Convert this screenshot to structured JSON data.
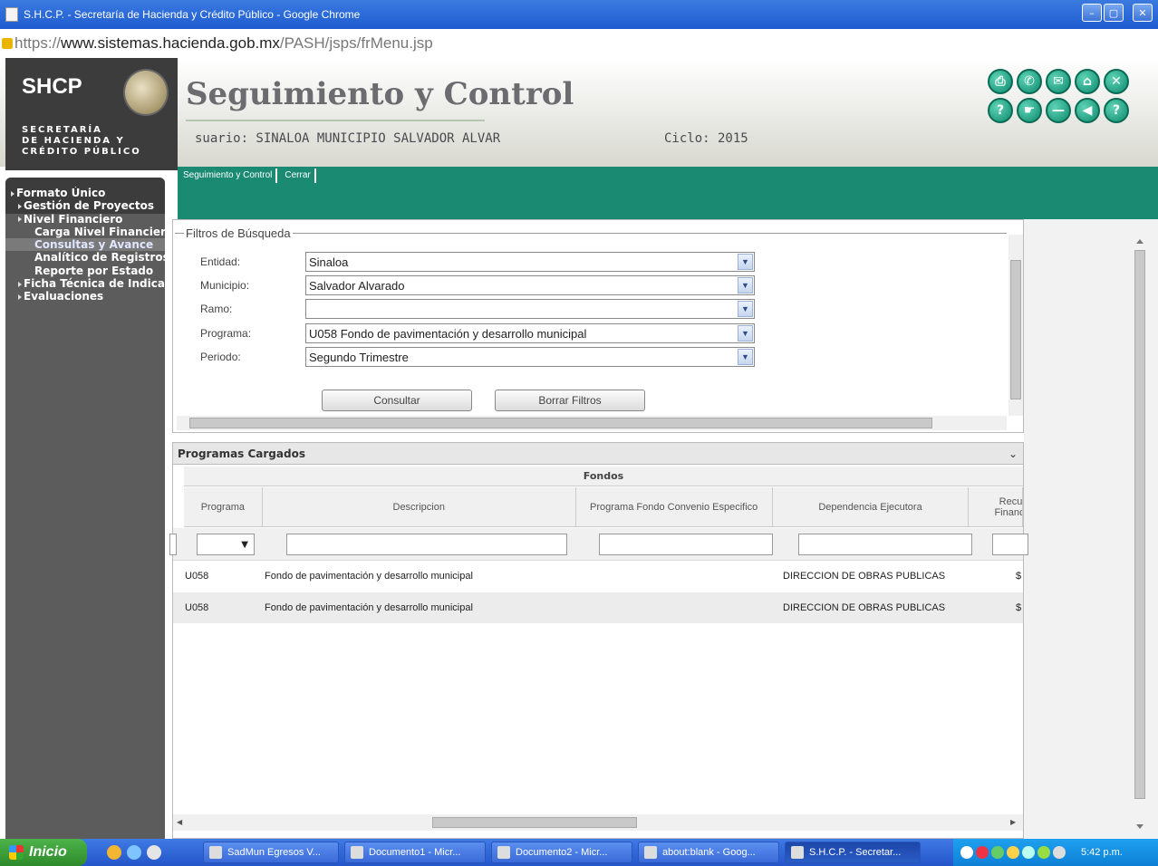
{
  "window": {
    "title": "S.H.C.P. - Secretaría de Hacienda y Crédito Público - Google Chrome",
    "url_prefix": "https://",
    "url_host": "www.sistemas.hacienda.gob.mx",
    "url_path": "/PASH/jsps/frMenu.jsp"
  },
  "header": {
    "logo_text": "SHCP",
    "logo_subtitle": "SECRETARÍA\nDE HACIENDA Y\nCRÉDITO PÚBLICO",
    "app_title": "Seguimiento y Control",
    "user_label": "suario: SINALOA MUNICIPIO SALVADOR ALVAR",
    "cycle_label": "Ciclo: 2015",
    "action_icons": [
      "printer-icon",
      "phone-icon",
      "mail-icon",
      "home-icon",
      "close-icon",
      "help-doc-icon",
      "pointer-icon",
      "minus-icon",
      "back-icon",
      "question-icon"
    ]
  },
  "tabs": [
    {
      "label": "Seguimiento y Control"
    },
    {
      "label": "Cerrar"
    }
  ],
  "sidebar": {
    "items": [
      {
        "label": "Formato Único",
        "level": 0,
        "active": false
      },
      {
        "label": "Gestión de Proyectos",
        "level": 1,
        "active": false
      },
      {
        "label": "Nivel Financiero",
        "level": 1,
        "active": false
      },
      {
        "label": "Carga Nivel Financiero",
        "level": 2,
        "active": false
      },
      {
        "label": "Consultas y Avance",
        "level": 2,
        "active": true
      },
      {
        "label": "Analítico de Registros",
        "level": 2,
        "active": false
      },
      {
        "label": "Reporte por Estado",
        "level": 2,
        "active": false
      },
      {
        "label": "Ficha Técnica de Indicadores",
        "level": 0,
        "active": false
      },
      {
        "label": "Evaluaciones",
        "level": 0,
        "active": false
      }
    ]
  },
  "filters": {
    "legend": "Filtros de Búsqueda",
    "fields": [
      {
        "label": "Entidad:",
        "value": "Sinaloa"
      },
      {
        "label": "Municipio:",
        "value": "Salvador Alvarado"
      },
      {
        "label": "Ramo:",
        "value": ""
      },
      {
        "label": "Programa:",
        "value": "U058 Fondo de pavimentación y desarrollo municipal"
      },
      {
        "label": "Periodo:",
        "value": "Segundo Trimestre"
      }
    ],
    "consult_button": "Consultar",
    "clear_button": "Borrar Filtros"
  },
  "grid": {
    "title": "Programas Cargados",
    "group_header": "Fondos",
    "columns": [
      "Programa",
      "Descripcion",
      "Programa Fondo Convenio Especifico",
      "Dependencia Ejecutora",
      "Recursos Financieros"
    ],
    "rows": [
      {
        "programa": "U058",
        "descripcion": "Fondo de pavimentación y desarrollo municipal",
        "convenio": "",
        "dependencia": "DIRECCION DE OBRAS PUBLICAS",
        "recursos": "$"
      },
      {
        "programa": "U058",
        "descripcion": "Fondo de pavimentación y desarrollo municipal",
        "convenio": "",
        "dependencia": "DIRECCION DE OBRAS PUBLICAS",
        "recursos": "$"
      }
    ]
  },
  "taskbar": {
    "start_label": "Inicio",
    "buttons": [
      {
        "label": "SadMun Egresos V...",
        "active": false
      },
      {
        "label": "Documento1 - Micr...",
        "active": false
      },
      {
        "label": "Documento2 - Micr...",
        "active": false
      },
      {
        "label": "about:blank - Goog...",
        "active": false
      },
      {
        "label": "S.H.C.P. - Secretar...",
        "active": true
      }
    ],
    "clock": "5:42 p.m."
  }
}
